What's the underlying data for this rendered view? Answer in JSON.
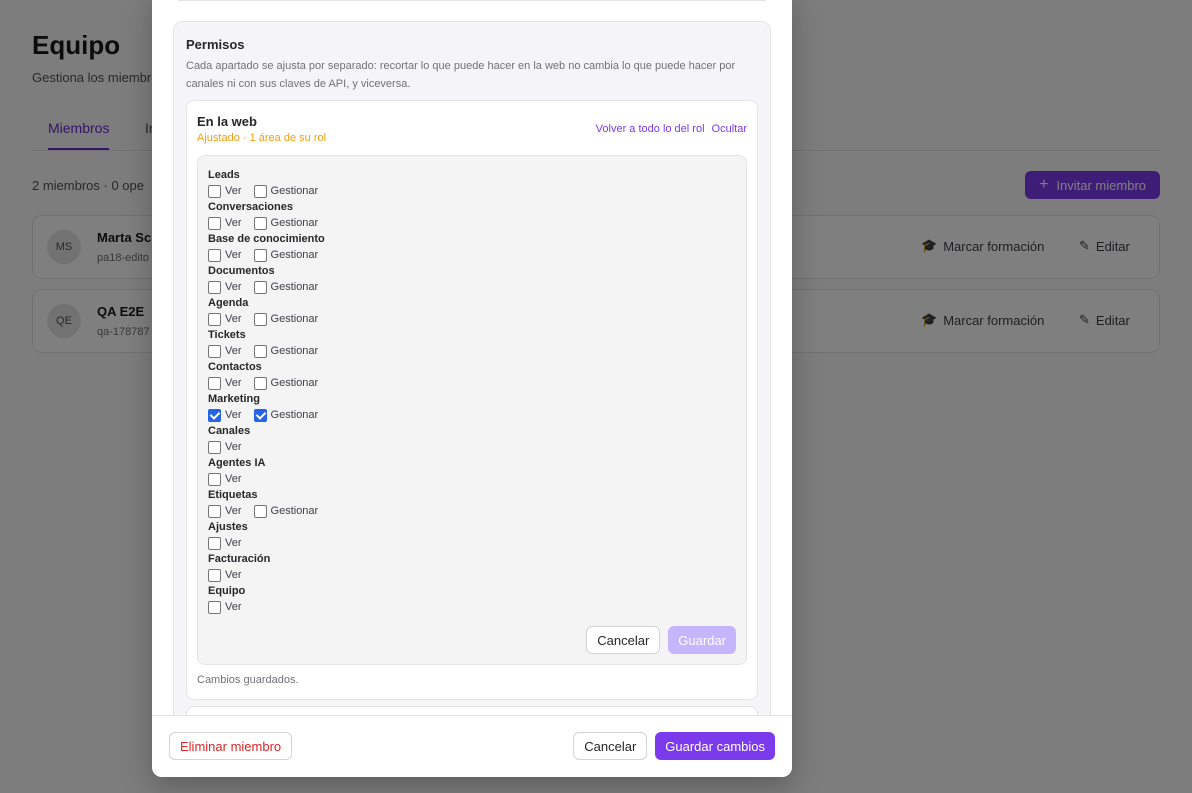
{
  "background": {
    "title": "Equipo",
    "subtitle": "Gestiona los miembros",
    "tabs": [
      {
        "label": "Miembros",
        "active": true
      },
      {
        "label": "In",
        "active": false
      }
    ],
    "count_label": "2 miembros · 0 ope",
    "invite_button": "Invitar miembro",
    "members": [
      {
        "initials": "MS",
        "name": "Marta Sc",
        "email": "pa18-edito",
        "training_action": "Marcar formación",
        "edit_action": "Editar"
      },
      {
        "initials": "QE",
        "name": "QA E2E",
        "email": "qa-178787",
        "training_action": "Marcar formación",
        "edit_action": "Editar"
      }
    ]
  },
  "modal": {
    "permissions": {
      "title": "Permisos",
      "description": "Cada apartado se ajusta por separado: recortar lo que puede hacer en la web no cambia lo que puede hacer por canales ni con sus claves de API, y viceversa.",
      "web": {
        "title": "En la web",
        "status": "Ajustado · 1 área de su rol",
        "reset_link": "Volver a todo lo del rol",
        "hide_link": "Ocultar",
        "view_label": "Ver",
        "manage_label": "Gestionar",
        "areas": [
          {
            "name": "Leads",
            "view": false,
            "manage": false,
            "has_manage": true
          },
          {
            "name": "Conversaciones",
            "view": false,
            "manage": false,
            "has_manage": true
          },
          {
            "name": "Base de conocimiento",
            "view": false,
            "manage": false,
            "has_manage": true
          },
          {
            "name": "Documentos",
            "view": false,
            "manage": false,
            "has_manage": true
          },
          {
            "name": "Agenda",
            "view": false,
            "manage": false,
            "has_manage": true
          },
          {
            "name": "Tickets",
            "view": false,
            "manage": false,
            "has_manage": true
          },
          {
            "name": "Contactos",
            "view": false,
            "manage": false,
            "has_manage": true
          },
          {
            "name": "Marketing",
            "view": true,
            "manage": true,
            "has_manage": true
          },
          {
            "name": "Canales",
            "view": false,
            "manage": false,
            "has_manage": false
          },
          {
            "name": "Agentes IA",
            "view": false,
            "manage": false,
            "has_manage": false
          },
          {
            "name": "Etiquetas",
            "view": false,
            "manage": false,
            "has_manage": true
          },
          {
            "name": "Ajustes",
            "view": false,
            "manage": false,
            "has_manage": false
          },
          {
            "name": "Facturación",
            "view": false,
            "manage": false,
            "has_manage": false
          },
          {
            "name": "Equipo",
            "view": false,
            "manage": false,
            "has_manage": false
          }
        ],
        "cancel_button": "Cancelar",
        "save_button": "Guardar",
        "saved_note": "Cambios guardados."
      }
    },
    "footer": {
      "delete_button": "Eliminar miembro",
      "cancel_button": "Cancelar",
      "save_button": "Guardar cambios"
    }
  },
  "colors": {
    "accent": "#7c3aed",
    "warning": "#f59e0b",
    "danger": "#dc2626",
    "checkbox": "#2563eb"
  }
}
